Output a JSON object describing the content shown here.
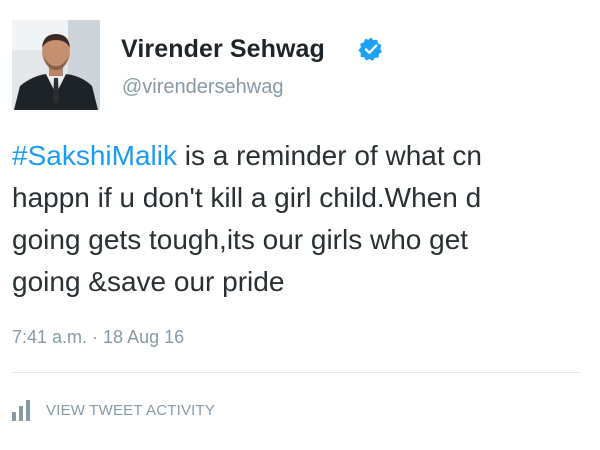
{
  "tweet": {
    "author": {
      "name": "Virender Sehwag",
      "handle": "@virendersehwag",
      "verified": true,
      "avatar_icon": "profile-photo"
    },
    "text_lines": [
      {
        "hashtag": "#SakshiMalik",
        "text": " is a reminder of what cn"
      },
      {
        "text": "happn if u don't kill a girl child.When d"
      },
      {
        "text": "going gets tough,its our girls who get"
      },
      {
        "text": "going &save our pride"
      }
    ],
    "timestamp": "7:41 a.m. · 18 Aug 16",
    "activity": {
      "label": "VIEW TWEET ACTIVITY",
      "icon": "bar-chart-icon"
    }
  },
  "colors": {
    "hashtag": "#1d9bf0",
    "verified_badge": "#1da1f2",
    "muted_text": "#8899a6",
    "body_text": "#292f33",
    "divider": "#e1e8ed"
  }
}
